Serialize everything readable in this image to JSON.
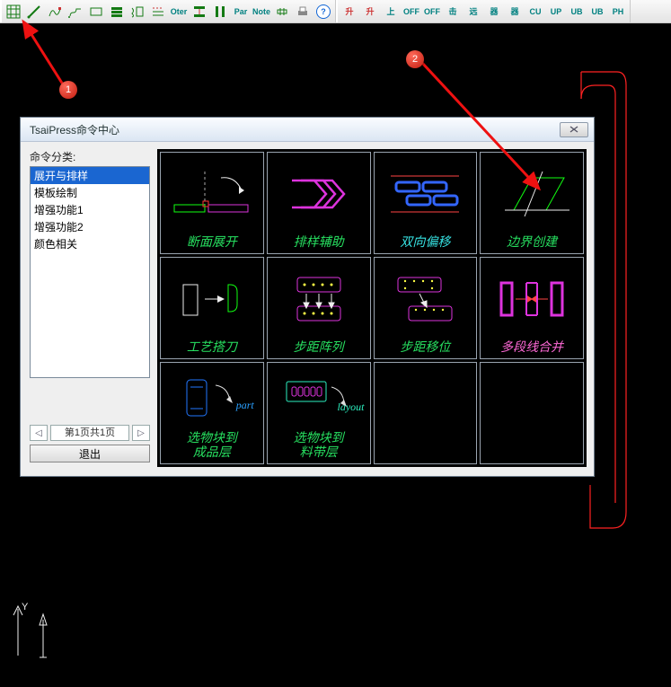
{
  "toolbar": {
    "group1": [
      "grid",
      "diag",
      "curve",
      "path",
      "rect",
      "stack",
      "squiggle",
      "dashstack",
      "Oter",
      "bars",
      "vert-bars",
      "par",
      "note",
      "bolt",
      "printer",
      "help"
    ],
    "group1_text": {
      "Oter": "Oter",
      "par": "Par",
      "note": "Note"
    },
    "group2_text": [
      "升",
      "升",
      "上",
      "OFF",
      "OFF",
      "击",
      "远",
      "器",
      "器",
      "CU",
      "UP",
      "UB",
      "UB",
      "PH"
    ]
  },
  "annotations": {
    "b1": "1",
    "b2": "2"
  },
  "dialog": {
    "title": "TsaiPress命令中心",
    "cat_label": "命令分类:",
    "categories": [
      "展开与排样",
      "模板绘制",
      "增强功能1",
      "增强功能2",
      "颜色相关"
    ],
    "selected_index": 0,
    "page_indicator": "第1页共1页",
    "exit": "退出",
    "tiles": [
      {
        "label": "断面展开"
      },
      {
        "label": "排样辅助"
      },
      {
        "label": "双向偏移",
        "label_color": "cyan"
      },
      {
        "label": "边界创建"
      },
      {
        "label": "工艺搭刀"
      },
      {
        "label": "步距阵列"
      },
      {
        "label": "步距移位"
      },
      {
        "label": "多段线合并",
        "label_color": "pink"
      },
      {
        "label": "选物块到\n成品层",
        "aux": "part",
        "aux_color": "#2aa0ff"
      },
      {
        "label": "选物块到\n料带层",
        "aux": "layout",
        "aux_color": "#2cf0c0"
      }
    ]
  },
  "triad": {
    "y": "Y"
  }
}
